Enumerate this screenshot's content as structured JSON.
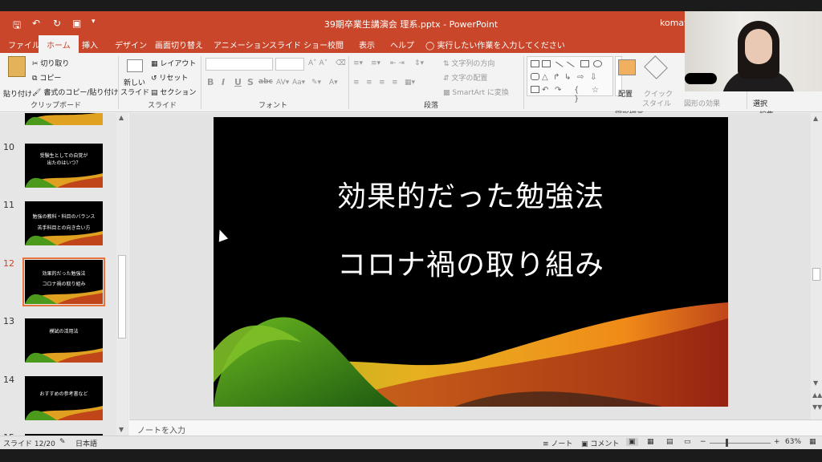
{
  "titlebar": {
    "doc_title": "39期卒業生講演会 理系.pptx - PowerPoint",
    "user": "komat",
    "qa_save_icon": "save-icon",
    "qa_undo_icon": "undo-icon",
    "qa_redo_icon": "redo-icon"
  },
  "tabs": [
    "ファイル",
    "ホーム",
    "挿入",
    "デザイン",
    "画面切り替え",
    "アニメーション",
    "スライド ショー",
    "校閲",
    "表示",
    "ヘルプ"
  ],
  "tell_me": "実行したい作業を入力してください",
  "ribbon": {
    "clipboard": {
      "paste": "貼り付け",
      "cut": "切り取り",
      "copy": "コピー",
      "format_painter": "書式のコピー/貼り付け",
      "label": "クリップボード"
    },
    "slides": {
      "new_slide": "新しい",
      "new_slide2": "スライド",
      "layout": "レイアウト",
      "reset": "リセット",
      "section": "セクション",
      "label": "スライド"
    },
    "font": {
      "label": "フォント",
      "bold": "B",
      "italic": "I",
      "underline": "U",
      "shadow": "S",
      "strike": "abc"
    },
    "paragraph": {
      "text_direction": "文字列の方向",
      "align_text": "文字の配置",
      "smartart": "SmartArt に変換",
      "label": "段落"
    },
    "drawing": {
      "arrange": "配置",
      "quick_styles": "クイック",
      "quick_styles2": "スタイル",
      "shape_effects": "図形の効果",
      "label": "図形描画"
    },
    "editing": {
      "select": "選択",
      "label": "編集"
    }
  },
  "thumbnails": [
    {
      "num": "10",
      "lines": [
        "受験生としての自覚が",
        "出たのはいつ？"
      ],
      "active": false
    },
    {
      "num": "11",
      "lines": [
        "勉強の教科・科目のバランス",
        "苦手科目との向き合い方"
      ],
      "active": false
    },
    {
      "num": "12",
      "lines": [
        "効果的だった勉強法",
        "コロナ禍の取り組み"
      ],
      "active": true
    },
    {
      "num": "13",
      "lines": [
        "模試の活用法"
      ],
      "active": false
    },
    {
      "num": "14",
      "lines": [
        "おすすめの参考書など"
      ],
      "active": false
    },
    {
      "num": "15",
      "lines": [],
      "active": false
    }
  ],
  "slide": {
    "title": "効果的だった勉強法",
    "subtitle": "コロナ禍の取り組み"
  },
  "notes_placeholder": "ノートを入力",
  "statusbar": {
    "slide_info": "スライド 12/20",
    "language": "日本語",
    "notes": "ノート",
    "comments": "コメント",
    "zoom": "63%"
  },
  "colors": {
    "accent": "#c9462a",
    "slide_bg": "#000000"
  }
}
